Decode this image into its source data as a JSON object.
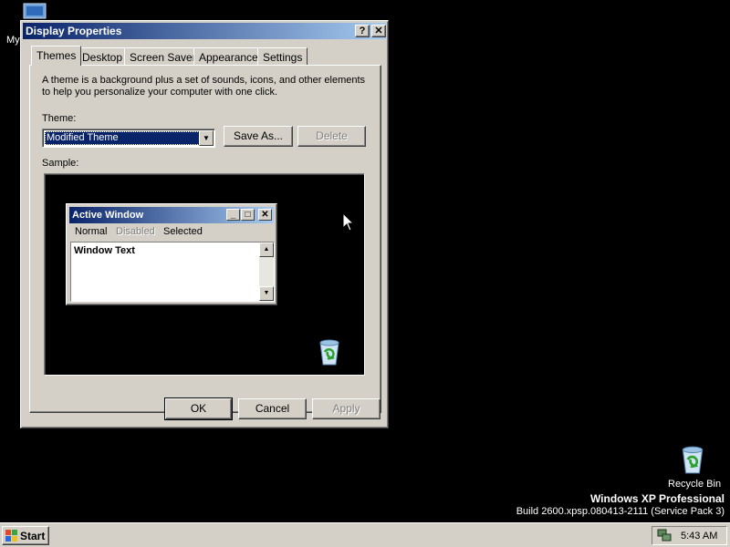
{
  "desktop": {
    "my_computer_label": "My",
    "recycle_bin_label": "Recycle Bin",
    "watermark_line1": "Windows XP Professional",
    "watermark_line2": "Build 2600.xpsp.080413-2111 (Service Pack 3)"
  },
  "window": {
    "title": "Display Properties",
    "help_glyph": "?",
    "close_glyph": "✕",
    "tabs": [
      {
        "label": "Themes",
        "active": true
      },
      {
        "label": "Desktop",
        "active": false
      },
      {
        "label": "Screen Saver",
        "active": false
      },
      {
        "label": "Appearance",
        "active": false
      },
      {
        "label": "Settings",
        "active": false
      }
    ],
    "description_line1": "A theme is a background plus a set of sounds, icons, and other elements",
    "description_line2": "to help you personalize your computer with one click.",
    "theme_label": "Theme:",
    "theme_value": "Modified Theme",
    "save_as_label": "Save As...",
    "delete_label": "Delete",
    "sample_label": "Sample:",
    "ok_label": "OK",
    "cancel_label": "Cancel",
    "apply_label": "Apply"
  },
  "sample_preview": {
    "active_window_title": "Active Window",
    "menu_normal": "Normal",
    "menu_disabled": "Disabled",
    "menu_selected": "Selected",
    "window_text": "Window Text"
  },
  "taskbar": {
    "start_label": "Start",
    "clock": "5:43 AM"
  },
  "colors": {
    "title_active_start": "#0a246a",
    "title_active_end": "#a6caf0",
    "face": "#d4d0c8",
    "desktop": "#000000"
  },
  "icons": [
    "my-computer-icon",
    "recycle-bin-icon",
    "cursor-icon",
    "windows-flag-icon",
    "network-tray-icon"
  ]
}
